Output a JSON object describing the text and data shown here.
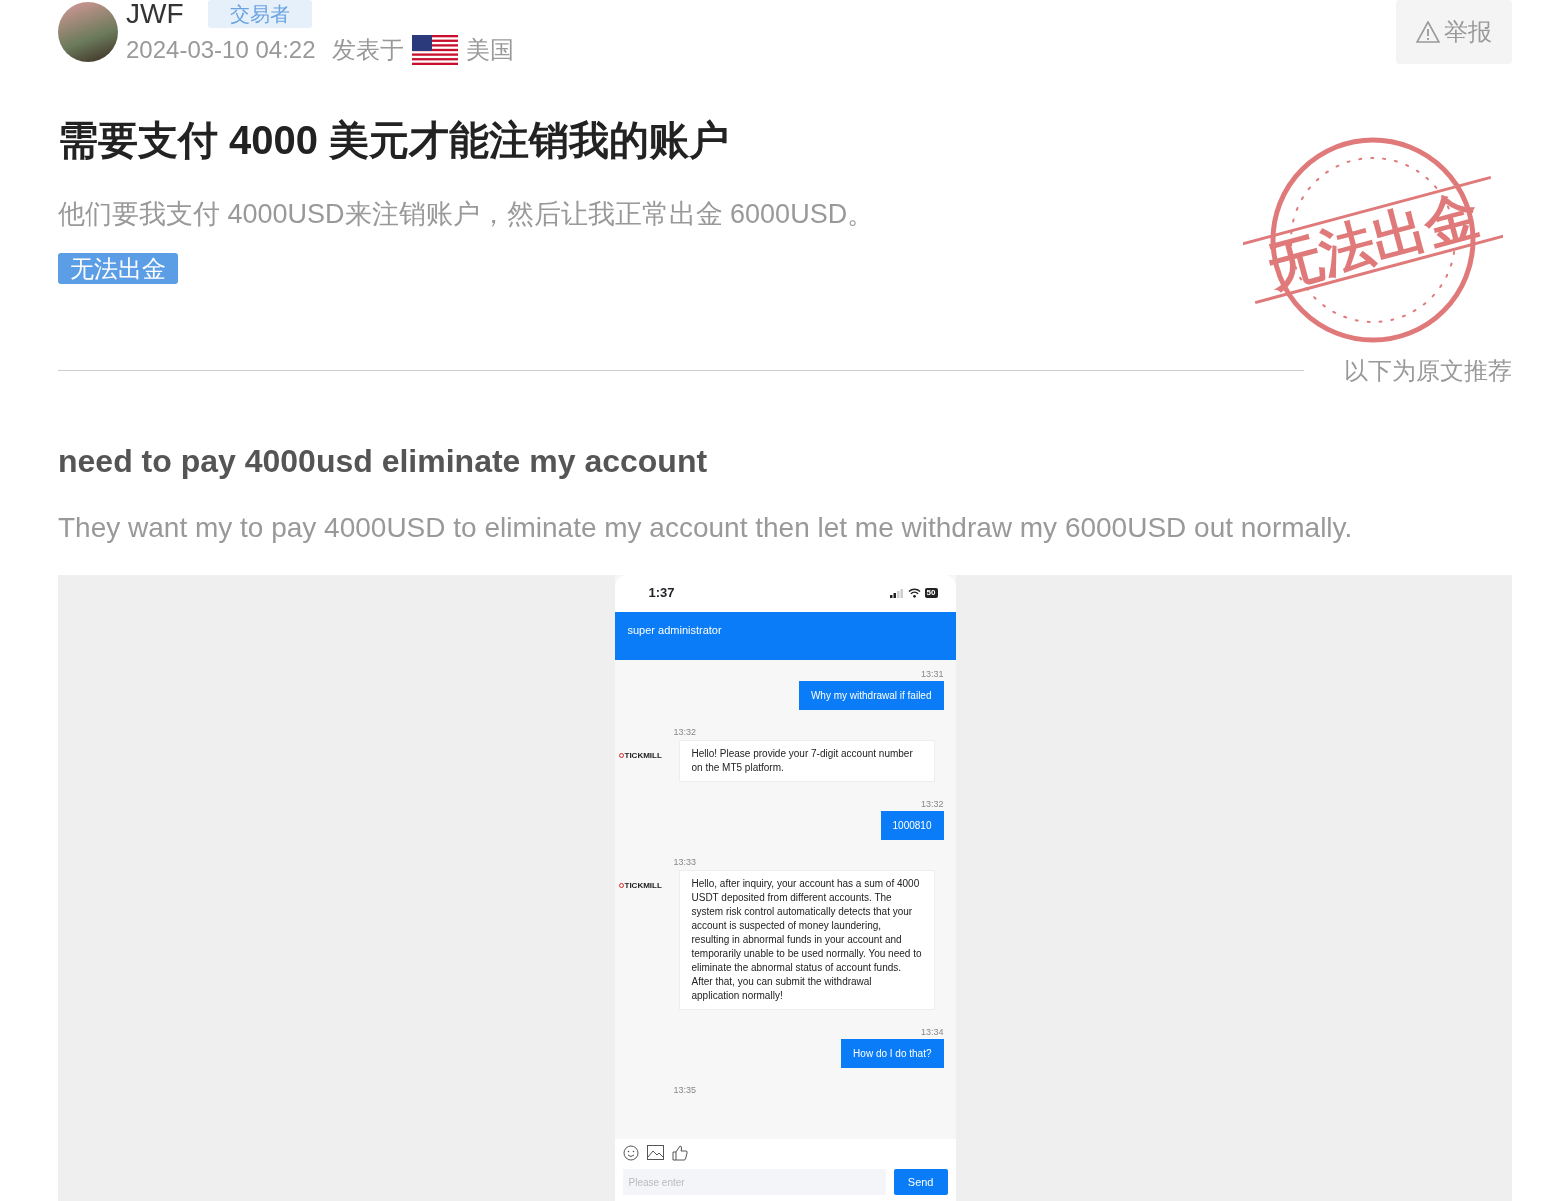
{
  "author": {
    "name": "JWF",
    "role": "交易者",
    "time": "2024-03-10 04:22",
    "posted_in": "发表于",
    "country": "美国"
  },
  "report_button": "举报",
  "stamp": "无法出金",
  "title": "需要支付 4000 美元才能注销我的账户",
  "summary": "他们要我支付 4000USD来注销账户，然后让我正常出金 6000USD。",
  "tag": "无法出金",
  "original_label": "以下为原文推荐",
  "original_title": "need to pay 4000usd eliminate my account",
  "original_body": "They want my to pay 4000USD to eliminate my account then let me withdraw my 6000USD out normally.",
  "phone": {
    "clock": "1:37",
    "battery": "50",
    "chat_title": "super administrator",
    "messages": [
      {
        "kind": "sent",
        "time": "13:31",
        "text": "Why my withdrawal if failed"
      },
      {
        "kind": "received",
        "time": "13:32",
        "logo_text": "TICKMILL",
        "text": "Hello! Please provide your 7-digit account number on the MT5 platform."
      },
      {
        "kind": "sent",
        "time": "13:32",
        "text": "1000810"
      },
      {
        "kind": "received",
        "time": "13:33",
        "logo_text": "TICKMILL",
        "text": "Hello, after inquiry, your account has a sum of 4000 USDT deposited from different accounts. The system risk control automatically detects that your account is suspected of money laundering, resulting in abnormal funds in your account and temporarily unable to be used normally. You need to eliminate the abnormal status of account funds. After that, you can submit the withdrawal application normally!"
      },
      {
        "kind": "sent",
        "time": "13:34",
        "text": "How do I do that?"
      },
      {
        "kind": "time",
        "time": "13:35"
      }
    ],
    "input_placeholder": "Please enter",
    "send_button": "Send"
  }
}
